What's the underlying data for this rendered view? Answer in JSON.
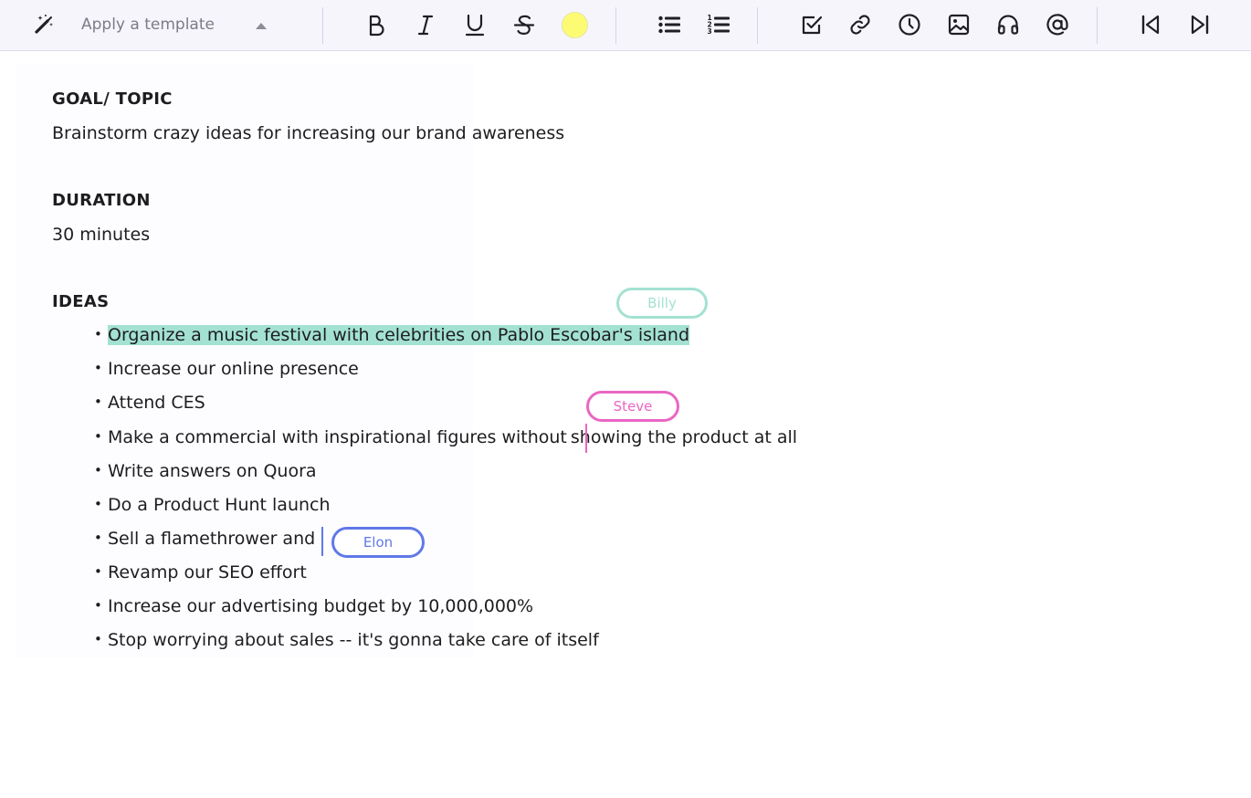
{
  "toolbar": {
    "magic_icon": "wand-icon",
    "template_placeholder": "Apply a template",
    "icons": {
      "bold": "bold-icon",
      "italic": "italic-icon",
      "underline": "underline-icon",
      "strike": "strikethrough-icon",
      "bullet_list": "bullet-list-icon",
      "numbered_list": "numbered-list-icon",
      "checkbox": "checkbox-icon",
      "link": "link-icon",
      "clock": "clock-icon",
      "image": "image-icon",
      "headphones": "headphones-icon",
      "mention": "at-sign-icon",
      "prev": "skip-back-icon",
      "next": "skip-forward-icon"
    },
    "highlight_color": "#fdfb74"
  },
  "document": {
    "goal_heading": "GOAL/ TOPIC",
    "goal_text": "Brainstorm crazy ideas for increasing our brand awareness",
    "duration_heading": "DURATION",
    "duration_text": "30 minutes",
    "ideas_heading": "IDEAS",
    "bullet_char": "•",
    "ideas": [
      "Organize a music festival with celebrities on Pablo Escobar's  island",
      "Increase our online presence",
      "Attend CES",
      "Make a commercial with inspirational figures without",
      "Write answers on Quora",
      "Do a Product Hunt launch",
      "Sell a flamethrower and",
      "Revamp our SEO effort",
      "Increase our advertising budget by 10,000,000%",
      "Stop worrying about sales -- it's gonna take care of itself"
    ],
    "idea4_after_cursor": "showing the product at all"
  },
  "collaborators": {
    "billy": {
      "name": "Billy",
      "color": "#a3e2d2"
    },
    "steve": {
      "name": "Steve",
      "color": "#ea66c4"
    },
    "elon": {
      "name": "Elon",
      "color": "#6079e8"
    }
  },
  "colors": {
    "toolbar_bg": "#f6f5fc",
    "icon": "#1f1f24",
    "text": "#1d1d1f"
  }
}
